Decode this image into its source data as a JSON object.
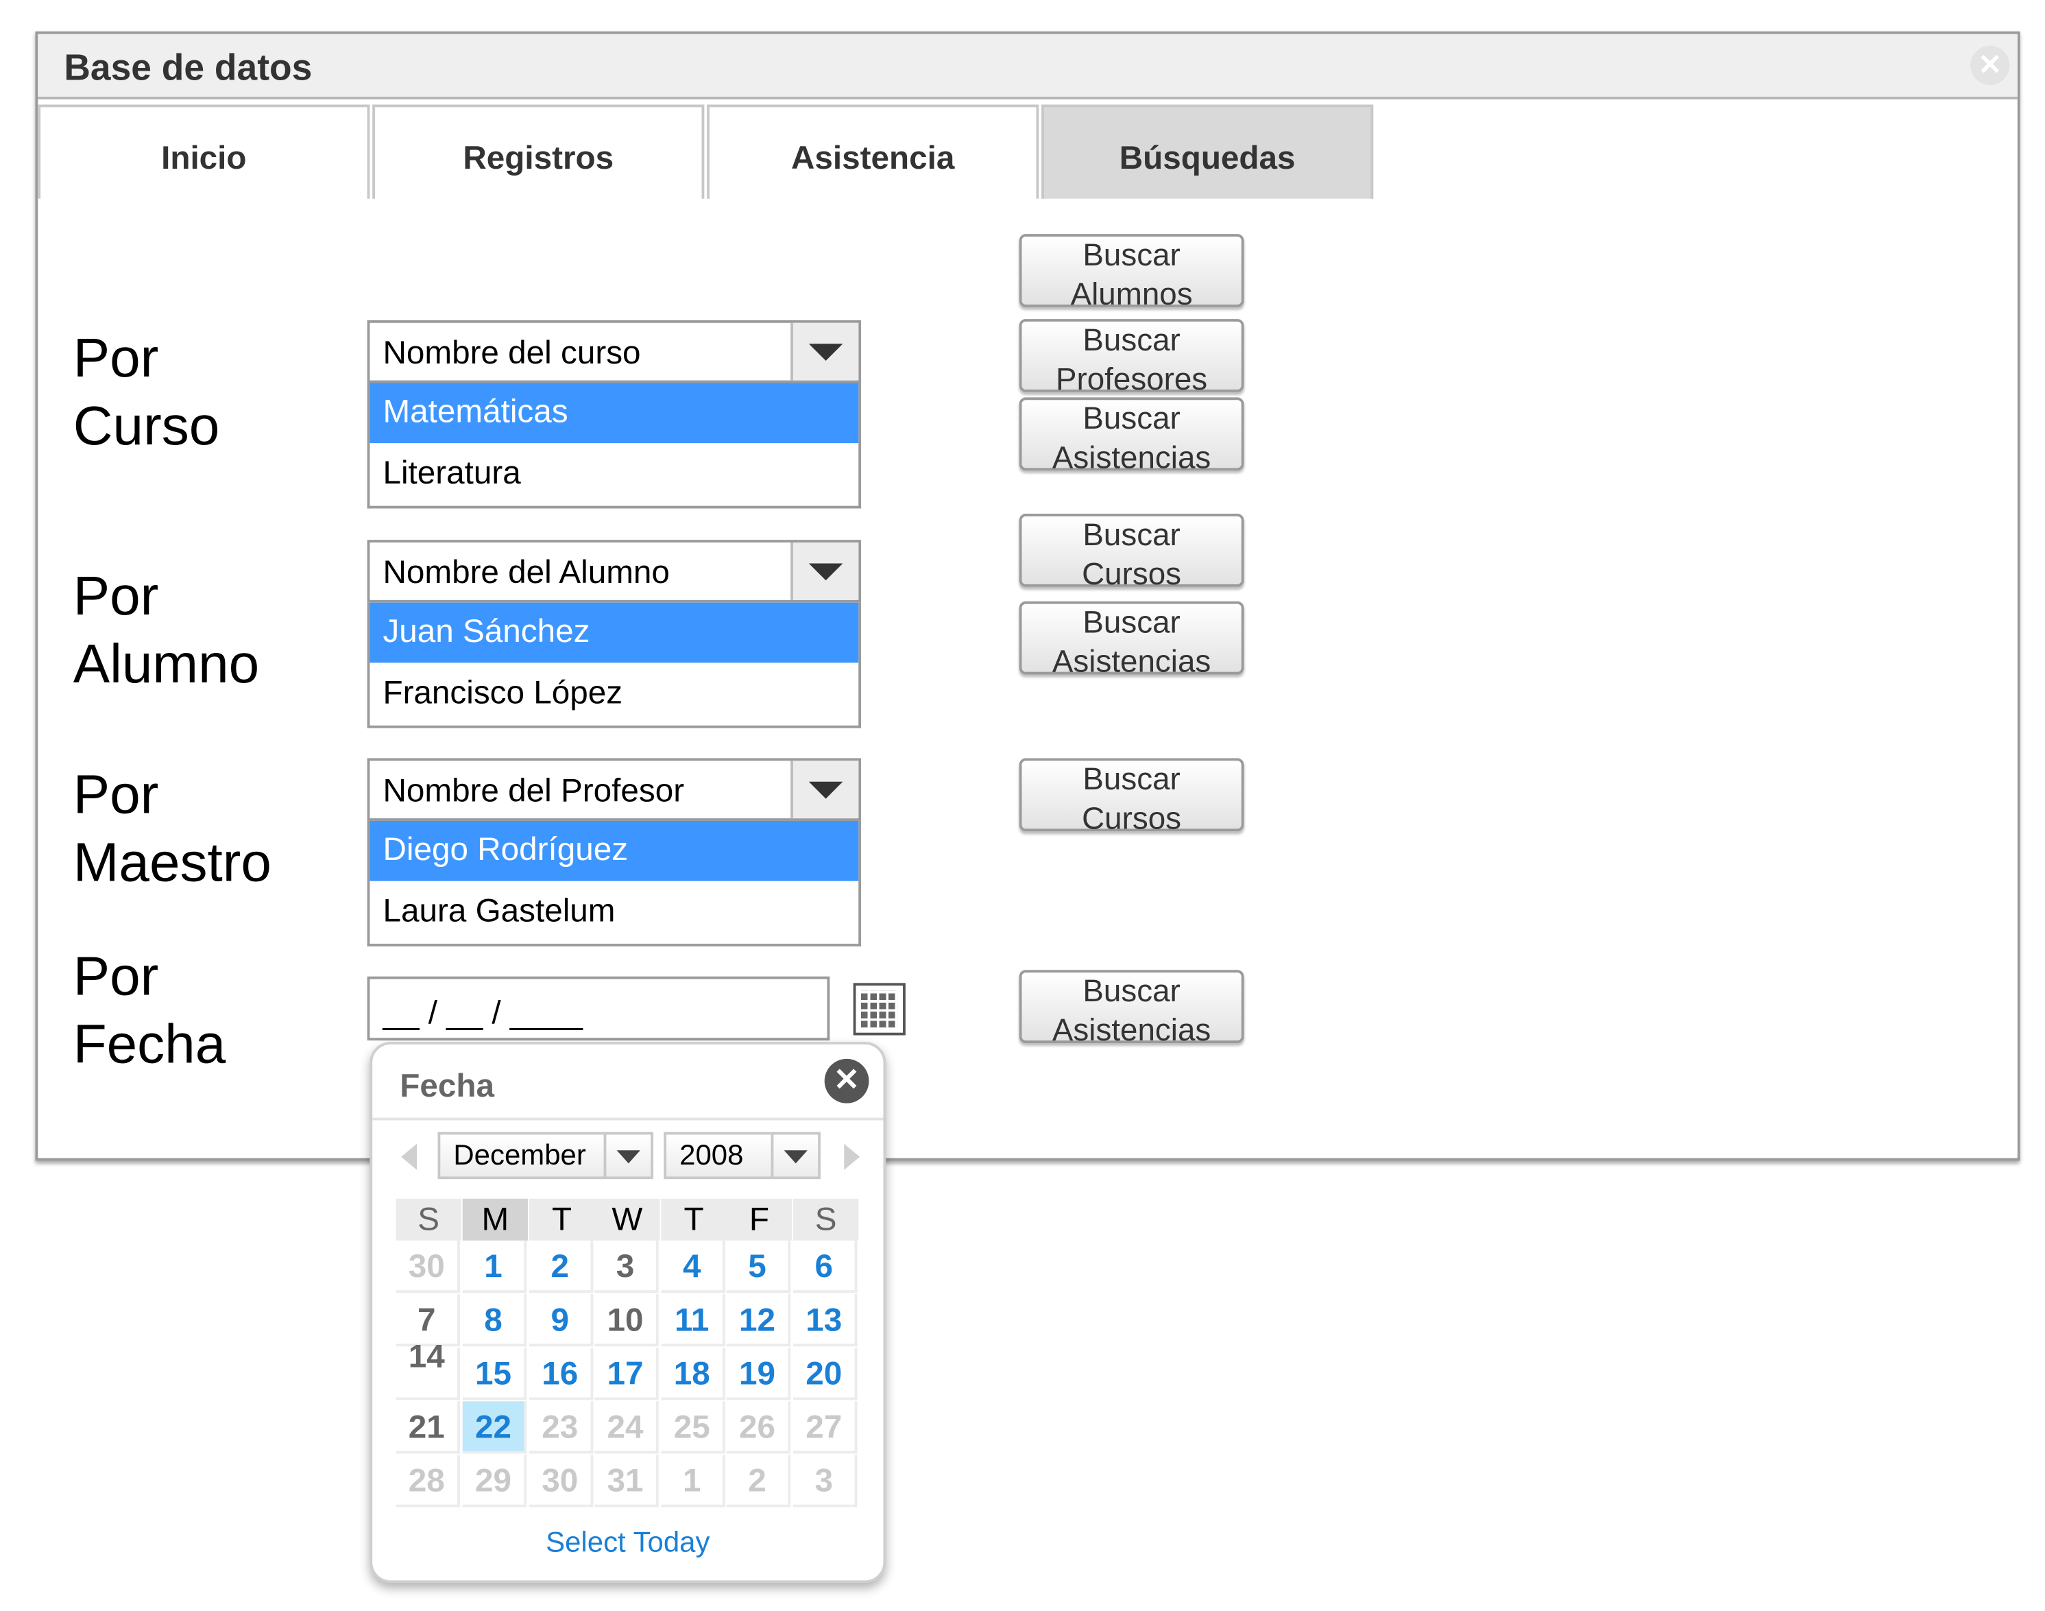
{
  "window": {
    "title": "Base de datos",
    "close_icon": "close-icon"
  },
  "tabs": [
    {
      "label": "Inicio",
      "active": false
    },
    {
      "label": "Registros",
      "active": false
    },
    {
      "label": "Asistencia",
      "active": false
    },
    {
      "label": "Búsquedas",
      "active": true
    }
  ],
  "sections": {
    "curso": {
      "label_line1": "Por",
      "label_line2": "Curso",
      "select_placeholder": "Nombre del curso",
      "options": [
        "Matemáticas",
        "Literatura"
      ],
      "selected_option": "Matemáticas",
      "buttons": [
        {
          "line1": "Buscar",
          "line2": "Alumnos"
        },
        {
          "line1": "Buscar",
          "line2": "Profesores"
        },
        {
          "line1": "Buscar",
          "line2": "Asistencias"
        }
      ]
    },
    "alumno": {
      "label_line1": "Por",
      "label_line2": "Alumno",
      "select_placeholder": "Nombre del Alumno",
      "options": [
        "Juan Sánchez",
        "Francisco López"
      ],
      "selected_option": "Juan Sánchez",
      "buttons": [
        {
          "line1": "Buscar",
          "line2": "Cursos"
        },
        {
          "line1": "Buscar",
          "line2": "Asistencias"
        }
      ]
    },
    "maestro": {
      "label_line1": "Por",
      "label_line2": "Maestro",
      "select_placeholder": "Nombre del Profesor",
      "options": [
        "Diego Rodríguez",
        "Laura Gastelum"
      ],
      "selected_option": "Diego Rodríguez",
      "buttons": [
        {
          "line1": "Buscar",
          "line2": "Cursos"
        }
      ]
    },
    "fecha": {
      "label_line1": "Por",
      "label_line2": "Fecha",
      "date_value": "__ / __ / ____",
      "buttons": [
        {
          "line1": "Buscar",
          "line2": "Asistencias"
        }
      ]
    }
  },
  "datepicker": {
    "title": "Fecha",
    "month": "December",
    "year": "2008",
    "weekdays": [
      "S",
      "M",
      "T",
      "W",
      "T",
      "F",
      "S"
    ],
    "weeks": [
      [
        "30",
        "1",
        "2",
        "3",
        "4",
        "5",
        "6"
      ],
      [
        "7",
        "8",
        "9",
        "10",
        "11",
        "12",
        "13"
      ],
      [
        "14",
        "15",
        "16",
        "17",
        "18",
        "19",
        "20"
      ],
      [
        "21",
        "22",
        "23",
        "24",
        "25",
        "26",
        "27"
      ],
      [
        "28",
        "29",
        "30",
        "31",
        "1",
        "2",
        "3"
      ]
    ],
    "today": "22",
    "select_today_label": "Select Today",
    "colors": {
      "link": "#1a7fd6",
      "today_bg": "#bde7fb",
      "selection": "#3d96ff"
    }
  }
}
